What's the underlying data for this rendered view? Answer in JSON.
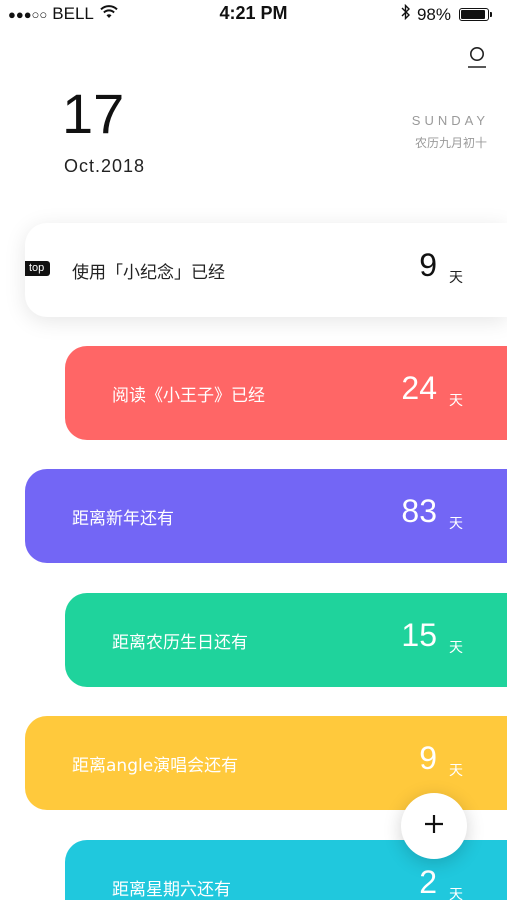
{
  "status_bar": {
    "signal": "●●●○○",
    "carrier": "BELL",
    "time": "4:21 PM",
    "battery_pct": "98%",
    "battery_level": 0.98
  },
  "header": {
    "day": "17",
    "month_year": "Oct.2018",
    "weekday": "SUNDAY",
    "lunar_date": "农历九月初十"
  },
  "colors": {
    "red": "#ff6666",
    "purple": "#7366f5",
    "green": "#1fd39c",
    "yellow": "#ffc93c",
    "cyan": "#20c8dd"
  },
  "cards": [
    {
      "label": "使用「小纪念」已经",
      "count": "9",
      "unit": "天",
      "badge": "top",
      "color": "#ffffff"
    },
    {
      "label": "阅读《小王子》已经",
      "count": "24",
      "unit": "天",
      "color": "#ff6666"
    },
    {
      "label": "距离新年还有",
      "count": "83",
      "unit": "天",
      "color": "#7366f5"
    },
    {
      "label": "距离农历生日还有",
      "count": "15",
      "unit": "天",
      "color": "#1fd39c"
    },
    {
      "label": "距离angle演唱会还有",
      "count": "9",
      "unit": "天",
      "color": "#ffc93c"
    },
    {
      "label": "距离星期六还有",
      "count": "2",
      "unit": "天",
      "color": "#20c8dd"
    }
  ],
  "icons": {
    "profile": "profile-icon",
    "add": "plus-icon",
    "wifi": "wifi-icon",
    "bluetooth": "bluetooth-icon",
    "battery": "battery-icon"
  }
}
